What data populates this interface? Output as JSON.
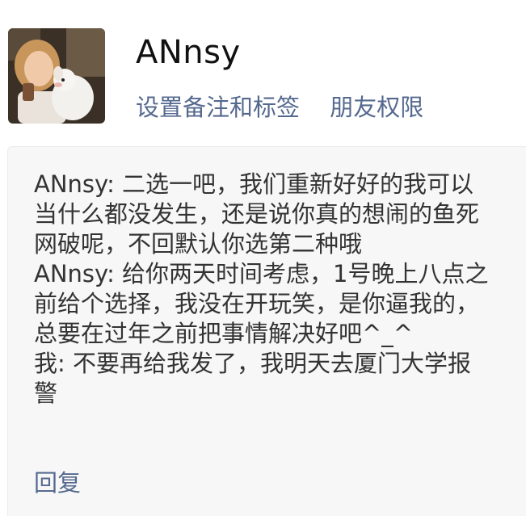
{
  "profile": {
    "name": "ANnsy",
    "avatar_icon": "profile-photo-girl-with-plush-toy"
  },
  "actions": {
    "set_remark_label": "设置备注和标签",
    "friend_permission_label": "朋友权限"
  },
  "message": {
    "lines": [
      "ANnsy: 二选一吧，我们重新好好的我可以",
      "当什么都没发生，还是说你真的想闹的鱼死",
      "网破呢，不回默认你选第二种哦",
      "ANnsy: 给你两天时间考虑，1号晚上八点之",
      "前给个选择，我没在开玩笑，是你逼我的，",
      "总要在过年之前把事情解决好吧^_^",
      "我: 不要再给我发了，我明天去厦门大学报",
      "警"
    ]
  },
  "reply_label": "回复",
  "colors": {
    "link": "#55698f",
    "text": "#333333",
    "card_bg": "#f7f7f7"
  }
}
